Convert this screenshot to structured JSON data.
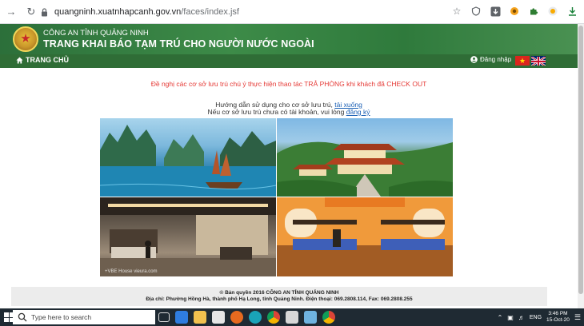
{
  "browser": {
    "url_host": "quangninh.xuatnhapcanh.gov.vn",
    "url_path": "/faces/index.jsf"
  },
  "header": {
    "org_name": "CÔNG AN TỈNH QUẢNG NINH",
    "title": "TRANG KHAI BÁO TẠM TRÚ CHO NGƯỜI NƯỚC NGOÀI"
  },
  "nav": {
    "home_label": "TRANG CHỦ",
    "login_label": "Đăng nhập"
  },
  "main": {
    "notice": "Đề nghị các cơ sở lưu trú chú ý thực hiện thao tác TRẢ PHÒNG khi khách đã CHECK OUT",
    "guide_text": "Hướng dẫn sử dụng cho cơ sở lưu trú,",
    "guide_link": "tải xuống",
    "register_text": "Nếu cơ sở lưu trú chưa có tài khoản, vui lòng",
    "register_link": "đăng ký",
    "photo_watermark": "+VBE House vieura.com"
  },
  "footer": {
    "copyright": "© Bản quyền 2016 CÔNG AN TỈNH QUẢNG NINH",
    "address": "Địa chỉ: Phường Hồng Hà, thành phố Hạ Long, tỉnh Quảng Ninh. Điện thoại: 069.2808.114, Fax: 069.2808.255"
  },
  "taskbar": {
    "search_placeholder": "Type here to search",
    "language": "ENG",
    "time": "3:46 PM",
    "date": "15-Oct-20"
  },
  "colors": {
    "header_green": "#2f7a3c",
    "notice_red": "#e53935",
    "link_blue": "#1a5fb4"
  }
}
